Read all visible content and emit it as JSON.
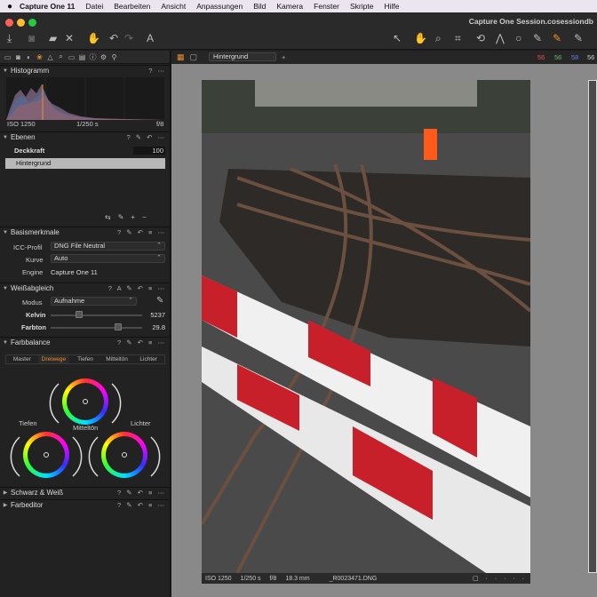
{
  "menubar": {
    "apple": "",
    "app_name": "Capture One 11",
    "items": [
      "Datei",
      "Bearbeiten",
      "Ansicht",
      "Anpassungen",
      "Bild",
      "Kamera",
      "Fenster",
      "Skripte",
      "Hilfe"
    ]
  },
  "window": {
    "title": "Capture One Session.cosessiondb"
  },
  "viewer_bar": {
    "layer_select": "Hintergrund",
    "readout": [
      "56",
      "56",
      "58",
      "56"
    ],
    "readout_colors": [
      "#e05050",
      "#60c060",
      "#6080e0",
      "#cccccc"
    ]
  },
  "histogram": {
    "title": "Histogramm",
    "iso": "ISO 1250",
    "shutter": "1/250 s",
    "aperture": "f/8"
  },
  "layers": {
    "title": "Ebenen",
    "opacity_label": "Deckkraft",
    "opacity_value": "100",
    "layer_name": "Hintergrund"
  },
  "base": {
    "title": "Basismerkmale",
    "icc_label": "ICC-Profil",
    "icc_value": "DNG File Neutral",
    "curve_label": "Kurve",
    "curve_value": "Auto",
    "engine_label": "Engine",
    "engine_value": "Capture One 11"
  },
  "wb": {
    "title": "Weißabgleich",
    "mode_label": "Modus",
    "mode_value": "Aufnahme",
    "kelvin_label": "Kelvin",
    "kelvin_value": "5237",
    "tint_label": "Farbton",
    "tint_value": "29.8"
  },
  "colorbalance": {
    "title": "Farbbalance",
    "tabs": [
      "Master",
      "Dreiwege",
      "Tiefen",
      "Mitteltön",
      "Lichter"
    ],
    "active_tab": "Dreiwege",
    "active_color": "#e8902a",
    "wheel_labels": {
      "shadows": "Tiefen",
      "mid": "Mitteltön",
      "high": "Lichter"
    }
  },
  "bw": {
    "title": "Schwarz & Weiß"
  },
  "coloreditor": {
    "title": "Farbeditor"
  },
  "caption": {
    "iso": "ISO 1250",
    "shutter": "1/250 s",
    "aperture": "f/8",
    "focal": "18.3 mm",
    "filename": "_R0023471.DNG"
  }
}
